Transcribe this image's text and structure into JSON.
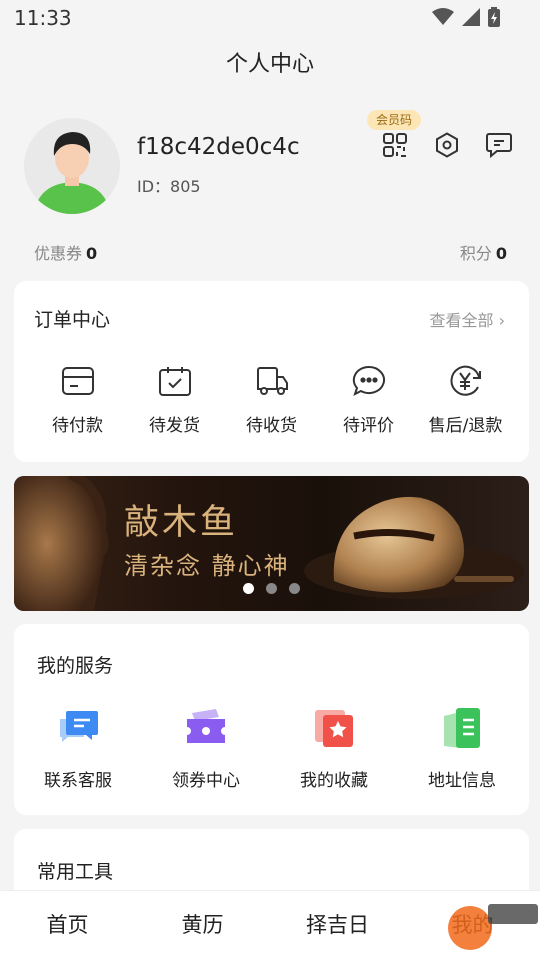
{
  "status_bar": {
    "time": "11:33"
  },
  "page_title": "个人中心",
  "profile": {
    "username": "f18c42de0c4c",
    "user_id": "ID：805",
    "member_badge": "会员码"
  },
  "stats": {
    "coupon_label": "优惠券",
    "coupon_value": "0",
    "points_label": "积分",
    "points_value": "0"
  },
  "orders": {
    "title": "订单中心",
    "view_all": "查看全部 ›",
    "items": [
      {
        "label": "待付款",
        "icon": "wallet-icon"
      },
      {
        "label": "待发货",
        "icon": "package-check-icon"
      },
      {
        "label": "待收货",
        "icon": "truck-icon"
      },
      {
        "label": "待评价",
        "icon": "chat-bubble-icon"
      },
      {
        "label": "售后/退款",
        "icon": "yen-refund-icon"
      }
    ]
  },
  "banner": {
    "title": "敲木鱼",
    "subtitle": "清杂念 静心神",
    "slide_count": 3,
    "active_slide": 1
  },
  "services": {
    "title": "我的服务",
    "items": [
      {
        "label": "联系客服",
        "icon": "customer-service-icon",
        "color": "#3d8bf2"
      },
      {
        "label": "领券中心",
        "icon": "coupon-icon",
        "color": "#8a5cf0"
      },
      {
        "label": "我的收藏",
        "icon": "favorite-icon",
        "color": "#f0524a"
      },
      {
        "label": "地址信息",
        "icon": "address-book-icon",
        "color": "#3cc25a"
      }
    ]
  },
  "tools": {
    "title": "常用工具"
  },
  "tabbar": {
    "tabs": [
      {
        "label": "首页"
      },
      {
        "label": "黄历"
      },
      {
        "label": "择吉日"
      },
      {
        "label": "我的"
      }
    ]
  }
}
